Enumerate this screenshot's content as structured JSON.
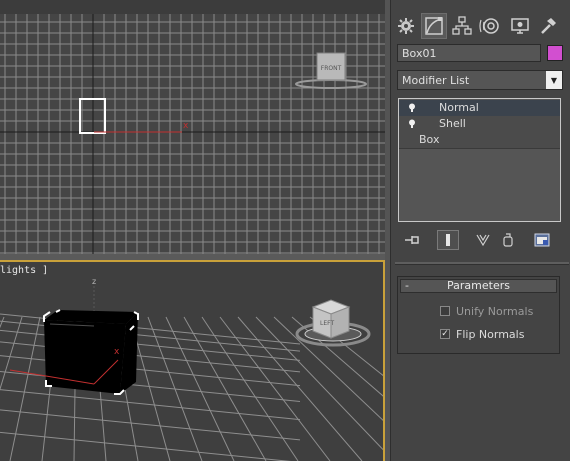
{
  "viewports": {
    "top": {
      "cube_label": "FRONT",
      "axis_x_label": "x"
    },
    "perspective": {
      "label": "lights ]",
      "cube_label": "LEFT",
      "axis_x_label": "x",
      "axis_z_label": "z"
    }
  },
  "command_panel": {
    "tabs": [
      {
        "icon": "sun-gear-icon",
        "name": "Create"
      },
      {
        "icon": "curve-edit-icon",
        "name": "Modify"
      },
      {
        "icon": "hierarchy-icon",
        "name": "Hierarchy"
      },
      {
        "icon": "motion-icon",
        "name": "Motion"
      },
      {
        "icon": "monitor-icon",
        "name": "Display"
      },
      {
        "icon": "hammer-icon",
        "name": "Utilities"
      }
    ],
    "object_name": "Box01",
    "object_color": "#d24fd0",
    "modifier_list_label": "Modifier List",
    "stack": [
      {
        "label": "Normal",
        "selected": true,
        "has_bulb": true
      },
      {
        "label": "Shell",
        "selected": false,
        "has_bulb": true
      },
      {
        "label": "Box",
        "selected": false,
        "has_bulb": false
      }
    ],
    "parameters": {
      "title": "Parameters",
      "collapse": "-",
      "options": [
        {
          "label": "Unify Normals",
          "checked": false,
          "check_mark": ""
        },
        {
          "label": "Flip Normals",
          "checked": true,
          "check_mark": "✓"
        }
      ]
    }
  },
  "colors": {
    "accent_active_border": "#c9a13a",
    "selection_row": "#3b434d",
    "axis_red": "#c23030"
  }
}
